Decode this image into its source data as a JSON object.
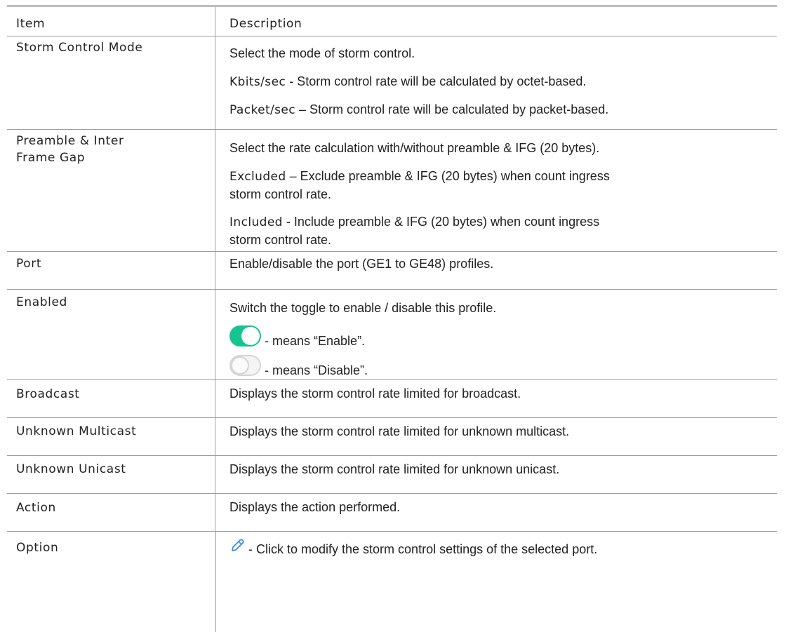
{
  "header": {
    "item": "Item",
    "description": "Description"
  },
  "rows": [
    {
      "item": "Storm Control Mode",
      "lines": [
        {
          "text": "Select the mode of storm control."
        },
        {
          "prefix": "Kbits/sec",
          "text": " - Storm control rate will be calculated by octet-based."
        },
        {
          "prefix": "Packet/sec",
          "text": " – Storm control rate will be calculated by packet-based."
        }
      ]
    },
    {
      "item_lines": [
        "Preamble & Inter",
        "Frame Gap"
      ],
      "lines": [
        {
          "text": "Select the rate calculation with/without preamble & IFG (20 bytes)."
        },
        {
          "prefix": "Excluded",
          "text": " – Exclude preamble & IFG (20 bytes) when count ingress"
        },
        {
          "text": "storm control rate."
        },
        {
          "prefix": "Included",
          "text": " - Include preamble & IFG (20 bytes) when count ingress"
        },
        {
          "text": "storm control rate."
        }
      ]
    },
    {
      "item": "Port",
      "lines": [
        {
          "text": "Enable/disable the port (GE1 to GE48) profiles."
        }
      ]
    },
    {
      "item": "Enabled",
      "lines": [
        {
          "text": "Switch the toggle to enable / disable this profile."
        },
        {
          "icon": "toggle-on-icon",
          "text": " - means “Enable”."
        },
        {
          "icon": "toggle-off-icon",
          "text": " - means “Disable”."
        }
      ]
    },
    {
      "item": "Broadcast",
      "lines": [
        {
          "text": "Displays the storm control rate limited for broadcast."
        }
      ]
    },
    {
      "item": "Unknown Multicast",
      "lines": [
        {
          "text": "Displays the storm control rate limited for unknown multicast."
        }
      ]
    },
    {
      "item": "Unknown Unicast",
      "lines": [
        {
          "text": "Displays the storm control rate limited for unknown unicast."
        }
      ]
    },
    {
      "item": "Action",
      "lines": [
        {
          "text": "Displays the action performed."
        }
      ]
    },
    {
      "item": "Option",
      "lines": [
        {
          "icon": "pencil-icon",
          "text": " - Click to modify the storm control settings of the selected port."
        }
      ]
    }
  ],
  "colors": {
    "toggle_on": "#14c58f",
    "toggle_off_border": "#d5d5d5",
    "pencil": "#3d8fe0",
    "rule": "#9c9c9c"
  }
}
